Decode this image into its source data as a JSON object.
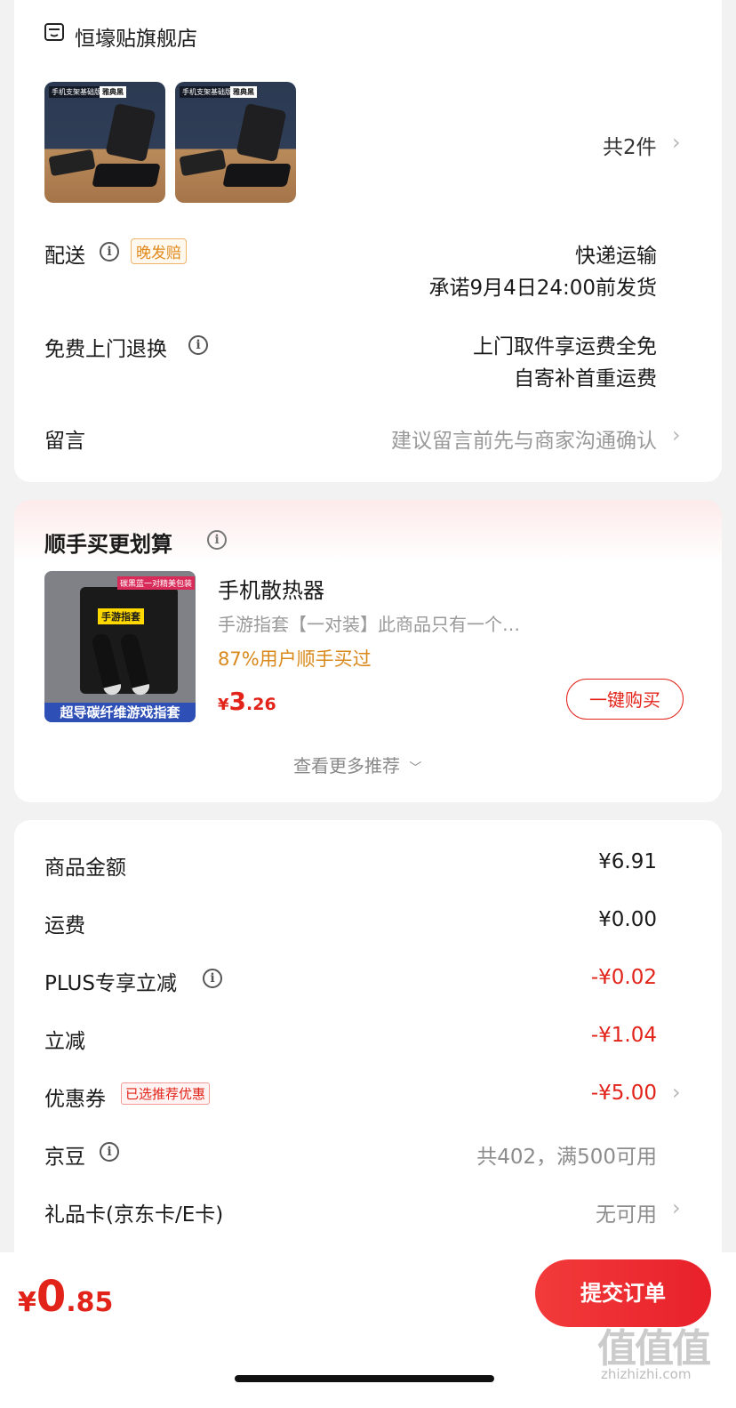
{
  "store": {
    "name": "恒壕贴旗舰店",
    "icon": "store-icon"
  },
  "products": {
    "thumb_label_1": "手机支架基础版",
    "thumb_label_2": "雅典黑",
    "count_text": "共2件"
  },
  "delivery": {
    "label": "配送",
    "tag": "晚发赔",
    "method": "快递运输",
    "promise": "承诺9月4日24:00前发货"
  },
  "returns": {
    "label": "免费上门退换",
    "line1": "上门取件享运费全免",
    "line2": "自寄补首重运费"
  },
  "message": {
    "label": "留言",
    "placeholder": "建议留言前先与商家沟通确认"
  },
  "addon": {
    "title": "顺手买更划算",
    "product_name": "手机散热器",
    "product_desc": "手游指套【一对装】此商品只有一个…",
    "buy_rate": "87%用户顺手买过",
    "price_symbol": "¥",
    "price_int": "3",
    "price_dec": ".26",
    "buy_button": "一键购买",
    "more": "查看更多推荐",
    "image_banner_top": "碳黑蓝一对精美包装",
    "image_pack_label": "手游指套",
    "image_banner_bottom": "超导碳纤维游戏指套"
  },
  "summary": {
    "rows": [
      {
        "label": "商品金额",
        "value": "¥6.91"
      },
      {
        "label": "运费",
        "value": "¥0.00"
      },
      {
        "label": "PLUS专享立减",
        "value": "-¥0.02"
      },
      {
        "label": "立减",
        "value": "-¥1.04"
      },
      {
        "label": "优惠券",
        "tag": "已选推荐优惠",
        "value": "-¥5.00"
      },
      {
        "label": "京豆",
        "value": "共402，满500可用"
      },
      {
        "label": "礼品卡(京东卡/E卡)",
        "value": "无可用"
      }
    ]
  },
  "footer": {
    "price_symbol": "¥",
    "price_int": "0",
    "price_dec": ".85",
    "submit": "提交订单"
  },
  "watermark": {
    "main": "值值值",
    "sub": "zhizhizhi.com"
  },
  "colors": {
    "accent": "#e2231a",
    "tag_orange": "#e08a1e",
    "price_orange": "#d9891c"
  }
}
